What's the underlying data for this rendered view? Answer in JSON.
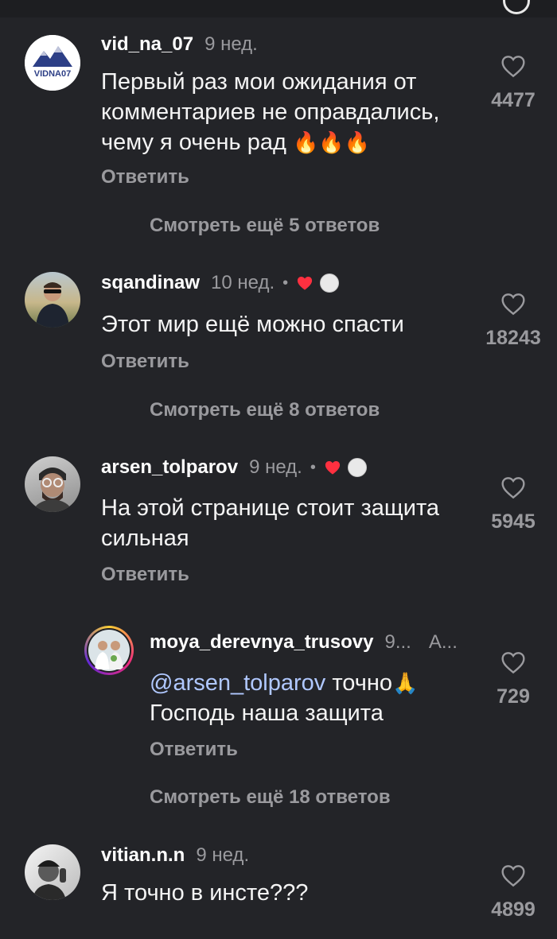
{
  "comments": [
    {
      "username": "vid_na_07",
      "time": "9 нед.",
      "text": "Первый раз мои ожидания от комментариев не оправдались, чему я очень рад",
      "emojis": "🔥🔥🔥",
      "reply_label": "Ответить",
      "likes": "4477",
      "avatar_logo_text": "VIDNA07",
      "more_replies": "Смотреть ещё 5 ответов"
    },
    {
      "username": "sqandinaw",
      "time": "10 нед.",
      "separator": "•",
      "text": "Этот мир ещё можно спасти",
      "reply_label": "Ответить",
      "likes": "18243",
      "more_replies": "Смотреть ещё 8 ответов"
    },
    {
      "username": "arsen_tolparov",
      "time": "9 нед.",
      "separator": "•",
      "text": "На этой странице стоит защита сильная",
      "reply_label": "Ответить",
      "likes": "5945"
    },
    {
      "username": "moya_derevnya_trusovy",
      "time": "9...",
      "extra": "А...",
      "mention": "@arsen_tolparov",
      "text": "точно",
      "emoji": "🙏",
      "text2": "Господь наша защита",
      "reply_label": "Ответить",
      "likes": "729",
      "more_replies": "Смотреть ещё 18 ответов"
    },
    {
      "username": "vitian.n.n",
      "time": "9 нед.",
      "text": "Я точно в инсте???",
      "likes": "4899"
    }
  ],
  "colors": {
    "background": "#232428",
    "muted": "#9a9a9e",
    "mention": "#b0c8ff",
    "heart": "#ff3040"
  }
}
